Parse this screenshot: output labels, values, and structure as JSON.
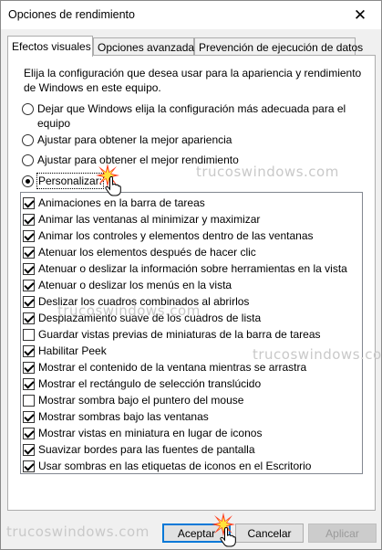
{
  "window": {
    "title": "Opciones de rendimiento",
    "close_glyph": "✕"
  },
  "tabs": [
    {
      "label": "Efectos visuales",
      "active": true
    },
    {
      "label": "Opciones avanzadas",
      "active": false
    },
    {
      "label": "Prevención de ejecución de datos",
      "active": false
    }
  ],
  "intro": "Elija la configuración que desea usar para la apariencia y rendimiento de Windows en este equipo.",
  "radios": [
    {
      "label": "Dejar que Windows elija la configuración más adecuada para el equipo",
      "checked": false
    },
    {
      "label": "Ajustar para obtener la mejor apariencia",
      "checked": false
    },
    {
      "label": "Ajustar para obtener el mejor rendimiento",
      "checked": false
    },
    {
      "label": "Personalizar:",
      "checked": true
    }
  ],
  "options": [
    {
      "label": "Animaciones en la barra de tareas",
      "checked": true
    },
    {
      "label": "Animar las ventanas al minimizar y maximizar",
      "checked": true
    },
    {
      "label": "Animar los controles y elementos dentro de las ventanas",
      "checked": true
    },
    {
      "label": "Atenuar los elementos después de hacer clic",
      "checked": true
    },
    {
      "label": "Atenuar o deslizar la información sobre herramientas en la vista",
      "checked": true
    },
    {
      "label": "Atenuar o deslizar los menús en la vista",
      "checked": true
    },
    {
      "label": "Deslizar los cuadros combinados al abrirlos",
      "checked": true
    },
    {
      "label": "Desplazamiento suave de los cuadros de lista",
      "checked": true
    },
    {
      "label": "Guardar vistas previas de miniaturas de la barra de tareas",
      "checked": false
    },
    {
      "label": "Habilitar Peek",
      "checked": true
    },
    {
      "label": "Mostrar el contenido de la ventana mientras se arrastra",
      "checked": true
    },
    {
      "label": "Mostrar el rectángulo de selección translúcido",
      "checked": true
    },
    {
      "label": "Mostrar sombra bajo el puntero del mouse",
      "checked": false
    },
    {
      "label": "Mostrar sombras bajo las ventanas",
      "checked": true
    },
    {
      "label": "Mostrar vistas en miniatura en lugar de iconos",
      "checked": true
    },
    {
      "label": "Suavizar bordes para las fuentes de pantalla",
      "checked": true
    },
    {
      "label": "Usar sombras en las etiquetas de iconos en el Escritorio",
      "checked": true
    }
  ],
  "watermark": "trucoswindows.com",
  "buttons": {
    "accept": "Aceptar",
    "cancel": "Cancelar",
    "apply": "Aplicar"
  }
}
